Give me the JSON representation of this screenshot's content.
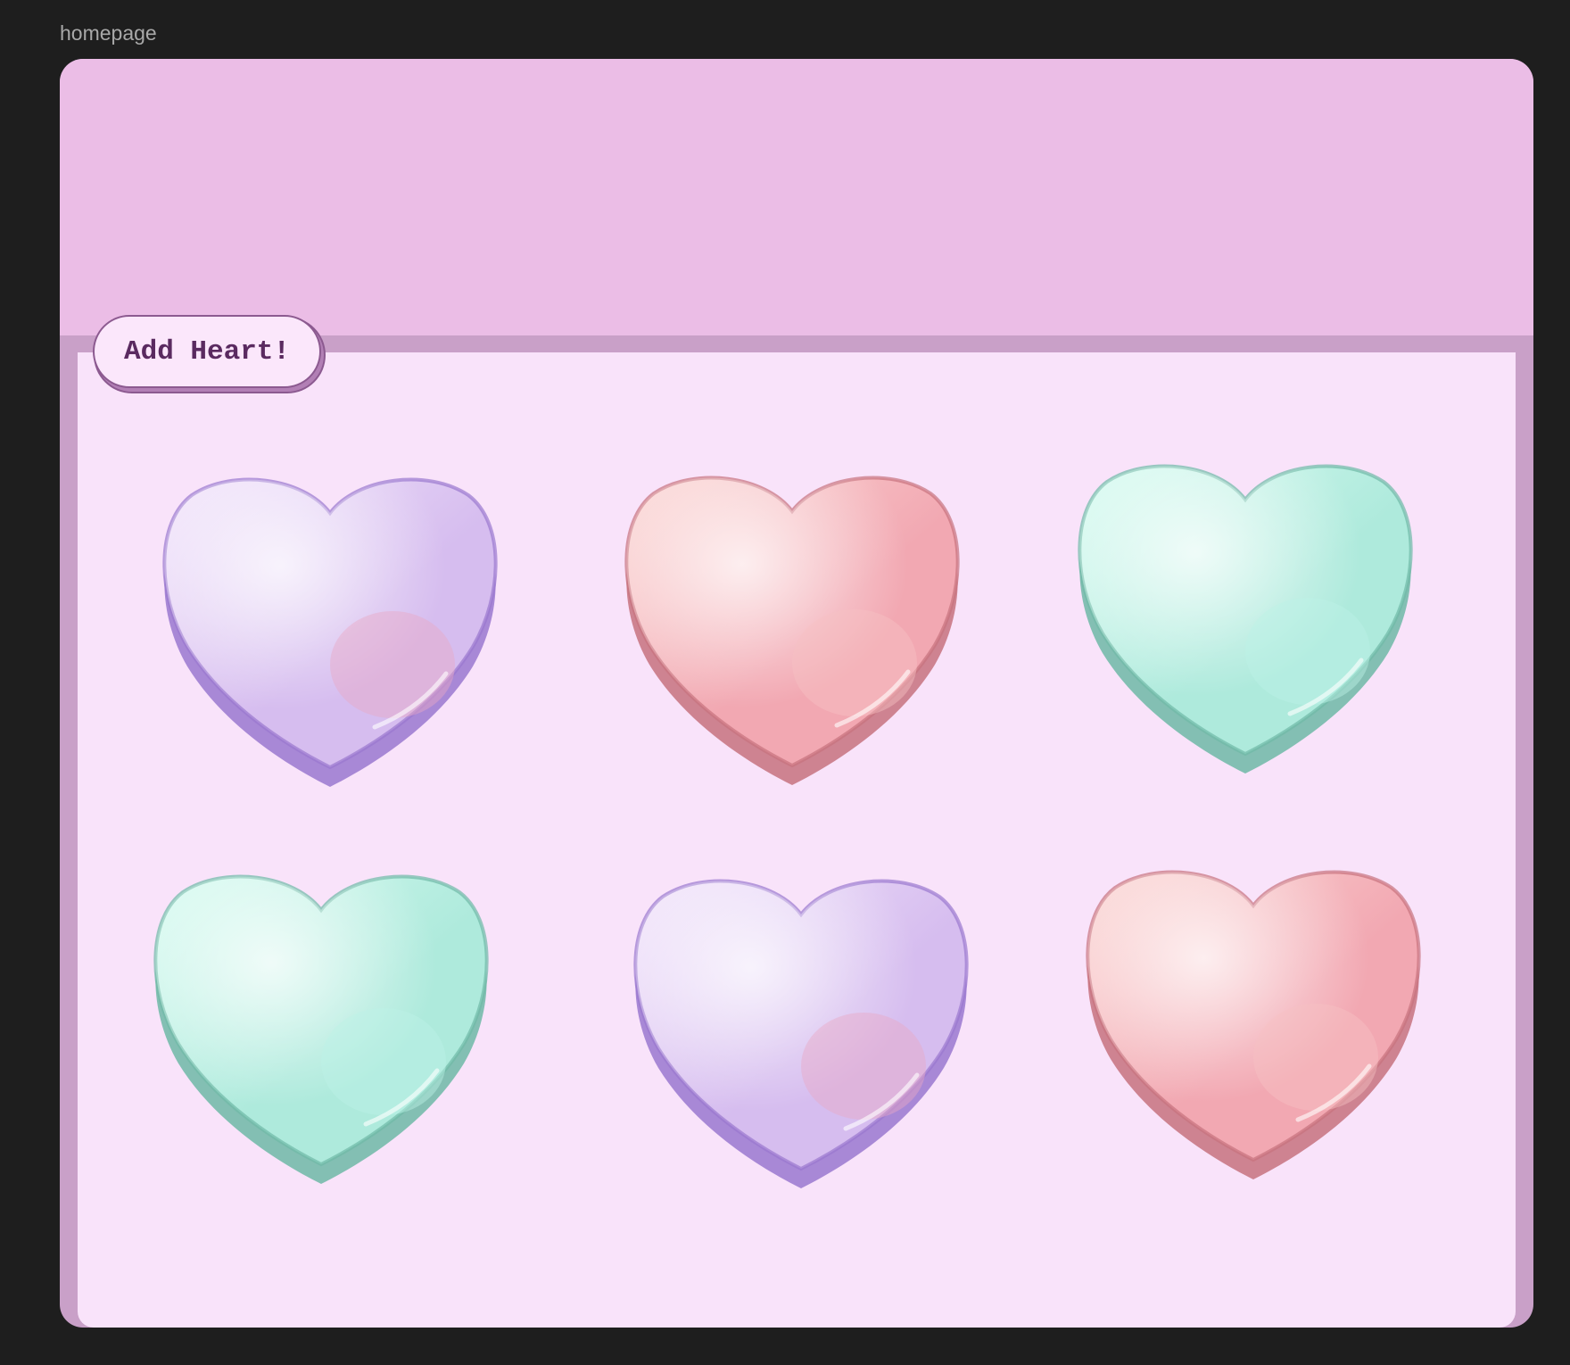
{
  "frame": {
    "label": "homepage"
  },
  "toolbar": {
    "add_heart_label": "Add Heart!"
  },
  "colors": {
    "lavender": {
      "light": "#f3e6fb",
      "mid": "#d6bdef",
      "dark": "#9a78cf",
      "accent": "#e9a9c6"
    },
    "pink": {
      "light": "#fbd8d6",
      "mid": "#f2a8b2",
      "dark": "#c7727e",
      "accent": "#f6c1c4"
    },
    "mint": {
      "light": "#d9fbf1",
      "mid": "#aeeadc",
      "dark": "#6fb9a6",
      "accent": "#bdf2e6"
    }
  },
  "hearts": [
    {
      "color": "lavender"
    },
    {
      "color": "pink"
    },
    {
      "color": "mint"
    },
    {
      "color": "mint"
    },
    {
      "color": "lavender"
    },
    {
      "color": "pink"
    }
  ]
}
